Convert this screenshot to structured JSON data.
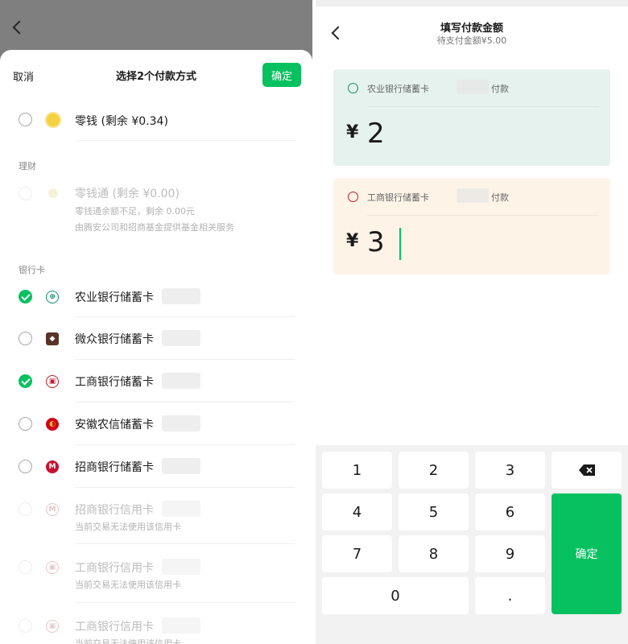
{
  "left": {
    "sheet": {
      "cancel": "取消",
      "title": "选择2个付款方式",
      "confirm": "确定"
    },
    "wallet": {
      "label": "零钱 (剩余 ¥0.34)"
    },
    "section_wealth": "理财",
    "fund": {
      "label": "零钱通 (剩余 ¥0.00)",
      "sub1": "零钱通余额不足，剩余 0.00元",
      "sub2": "由腾安公司和招商基金提供基金相关服务"
    },
    "section_bank": "银行卡",
    "banks": [
      {
        "label": "农业银行储蓄卡",
        "checked": true,
        "icon": "abc-bank-icon",
        "color": "#0e8f6b"
      },
      {
        "label": "微众银行储蓄卡",
        "checked": false,
        "icon": "webank-icon",
        "color": "#6b3a2a"
      },
      {
        "label": "工商银行储蓄卡",
        "checked": true,
        "icon": "icbc-bank-icon",
        "color": "#c7162b"
      },
      {
        "label": "安徽农信储蓄卡",
        "checked": false,
        "icon": "ahrcu-bank-icon",
        "color": "#d0021b"
      },
      {
        "label": "招商银行储蓄卡",
        "checked": false,
        "icon": "cmb-bank-icon",
        "color": "#c8102e"
      }
    ],
    "disabled_cards": [
      {
        "label": "招商银行信用卡",
        "sub": "当前交易无法使用该信用卡"
      },
      {
        "label": "工商银行信用卡",
        "sub": "当前交易无法使用该信用卡"
      },
      {
        "label": "工商银行信用卡",
        "sub": "当前交易无法使用该信用卡"
      }
    ]
  },
  "right": {
    "title": "填写付款金额",
    "subtitle": "待支付金额¥5.00",
    "cards": [
      {
        "label": "农业银行储蓄卡",
        "suffix": "付款",
        "yen": "¥",
        "amount": "2",
        "bg": "#e6f2ee",
        "icon_color": "#0e8f6b"
      },
      {
        "label": "工商银行储蓄卡",
        "suffix": "付款",
        "yen": "¥",
        "amount": "3",
        "bg": "#fdf4e7",
        "icon_color": "#c7162b"
      }
    ],
    "keypad": {
      "keys": [
        "1",
        "2",
        "3",
        "4",
        "5",
        "6",
        "7",
        "8",
        "9",
        "0",
        "."
      ],
      "confirm": "确定",
      "delete_icon": "backspace-icon"
    }
  },
  "colors": {
    "accent": "#07c160",
    "overlay": "#7f7f7f"
  }
}
